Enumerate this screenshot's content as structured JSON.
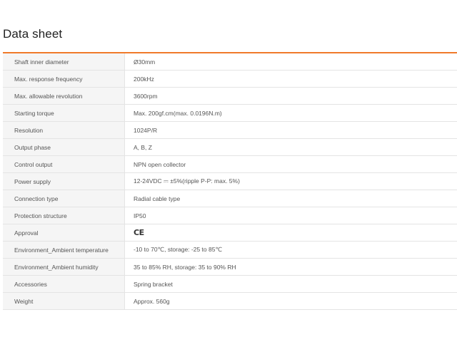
{
  "datasheet": {
    "title": "Data sheet",
    "accent_color": "#f07a2a",
    "rows": [
      {
        "label": "Shaft inner diameter",
        "value": "Ø30mm"
      },
      {
        "label": "Max. response frequency",
        "value": "200kHz"
      },
      {
        "label": "Max. allowable revolution",
        "value": "3600rpm"
      },
      {
        "label": "Starting torque",
        "value": "Max. 200gf.cm(max. 0.0196N.m)"
      },
      {
        "label": "Resolution",
        "value": "1024P/R"
      },
      {
        "label": "Output phase",
        "value": "A, B, Z"
      },
      {
        "label": "Control output",
        "value": "NPN open collector"
      },
      {
        "label": "Power supply",
        "value": "12-24VDC ⎓ ±5%(ripple P-P: max. 5%)"
      },
      {
        "label": "Connection type",
        "value": "Radial cable type"
      },
      {
        "label": "Protection structure",
        "value": "IP50"
      },
      {
        "label": "Approval",
        "value": "CE"
      },
      {
        "label": "Environment_Ambient temperature",
        "value": "-10 to 70℃, storage: -25 to 85℃"
      },
      {
        "label": "Environment_Ambient humidity",
        "value": "35 to 85% RH, storage: 35 to 90% RH"
      },
      {
        "label": "Accessories",
        "value": "Spring bracket"
      },
      {
        "label": "Weight",
        "value": "Approx. 560g"
      }
    ]
  }
}
